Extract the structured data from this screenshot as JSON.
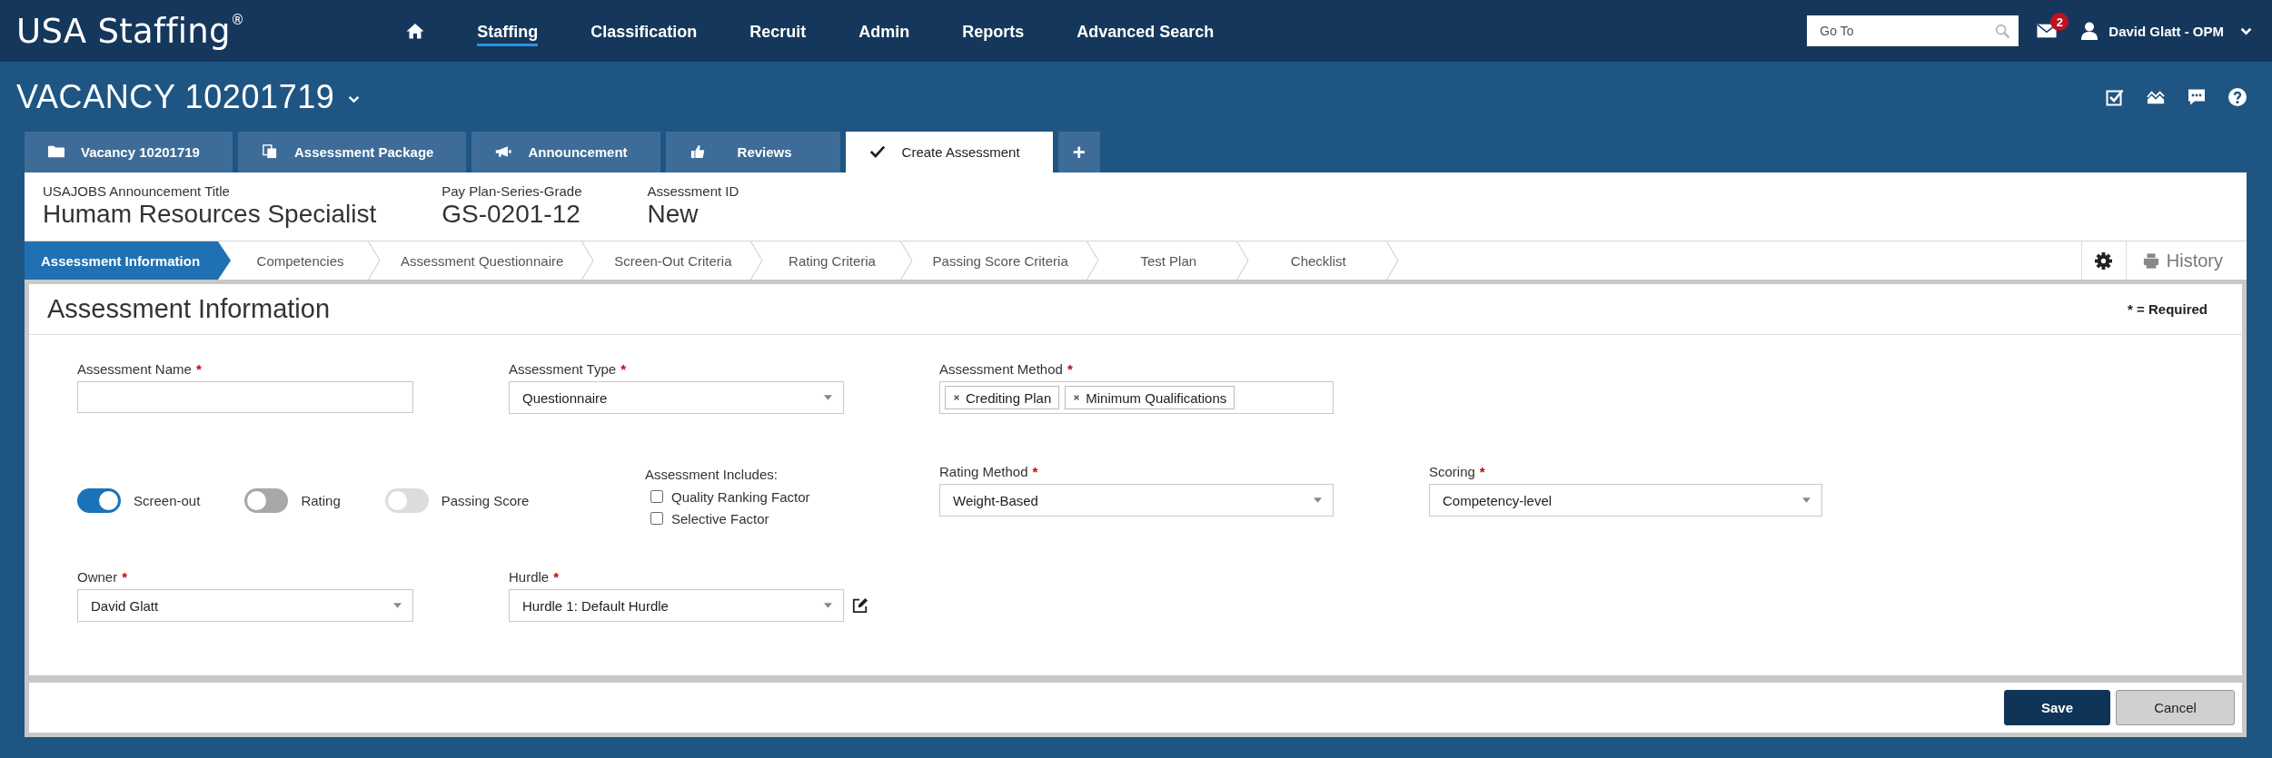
{
  "top_bar": {
    "logo": "USA Staffing$^{®}$",
    "nav": [
      {
        "label": "Staffing",
        "selected": true
      },
      {
        "label": "Classification",
        "selected": false
      },
      {
        "label": "Recruit",
        "selected": false
      },
      {
        "label": "Admin",
        "selected": false
      },
      {
        "label": "Reports",
        "selected": false
      },
      {
        "label": "Advanced Search",
        "selected": false
      }
    ],
    "search": {
      "placeholder": "Go To"
    },
    "message_count": "2",
    "user_name": "David Glatt - OPM"
  },
  "vacancy_title": "VACANCY 10201719",
  "tabs": [
    {
      "label": "Vacancy 10201719",
      "selected": false
    },
    {
      "label": "Assessment Package",
      "selected": false
    },
    {
      "label": "Announcement",
      "selected": false
    },
    {
      "label": "Reviews",
      "selected": false
    },
    {
      "label": "Create Assessment",
      "selected": true
    }
  ],
  "add_tab": "+",
  "summary": [
    {
      "label": "USAJOBS Announcement Title",
      "value": "Humam Resources Specialist"
    },
    {
      "label": "Pay Plan-Series-Grade",
      "value": "GS-0201-12"
    },
    {
      "label": "Assessment ID",
      "value": "New"
    }
  ],
  "steps": [
    {
      "label": "Assessment Information",
      "selected": true
    },
    {
      "label": "Competencies",
      "selected": false
    },
    {
      "label": "Assessment Questionnaire",
      "selected": false
    },
    {
      "label": "Screen-Out Criteria",
      "selected": false
    },
    {
      "label": "Rating Criteria",
      "selected": false
    },
    {
      "label": "Passing Score Criteria",
      "selected": false
    },
    {
      "label": "Test Plan",
      "selected": false
    },
    {
      "label": "Checklist",
      "selected": false
    }
  ],
  "history_button": "History",
  "section": {
    "title": "Assessment Information",
    "required_note": "* = Required"
  },
  "form": {
    "rows": [
      [
        {
          "kind": "text",
          "label": "Assessment Name",
          "required_mark": "*"
        },
        {
          "kind": "select",
          "label": "Assessment Type",
          "required_mark": "*",
          "value": "Questionnaire"
        },
        {
          "kind": "tags",
          "label": "Assessment Method",
          "required_mark": "*",
          "tags": [
            "Crediting Plan",
            "Minimum Qualifications"
          ]
        }
      ],
      [
        {
          "kind": "toggles",
          "items": [
            {
              "label": "Screen-out",
              "on": true,
              "disabled": false
            },
            {
              "label": "Rating",
              "on": false,
              "disabled": false
            },
            {
              "label": "Passing Score",
              "on": false,
              "disabled": true
            }
          ]
        },
        {
          "kind": "checklist",
          "label": "Assessment Includes:",
          "options": [
            {
              "label": "Quality Ranking Factor",
              "checked": false
            },
            {
              "label": "Selective Factor",
              "checked": false
            }
          ]
        },
        {
          "kind": "select",
          "label": "Rating Method",
          "required_mark": "*",
          "value": "Weight-Based"
        },
        {
          "kind": "select",
          "label": "Scoring",
          "required_mark": "*",
          "value": "Competency-level"
        }
      ],
      [
        {
          "kind": "select",
          "label": "Owner",
          "required_mark": "*",
          "value": "David Glatt"
        },
        {
          "kind": "select",
          "label": "Hurdle",
          "required_mark": "*",
          "value": "Hurdle 1: Default Hurdle",
          "editable": true
        }
      ]
    ]
  },
  "footer_buttons": [
    {
      "label": "Save",
      "kind": "primary"
    },
    {
      "label": "Cancel",
      "kind": "secondary"
    }
  ]
}
